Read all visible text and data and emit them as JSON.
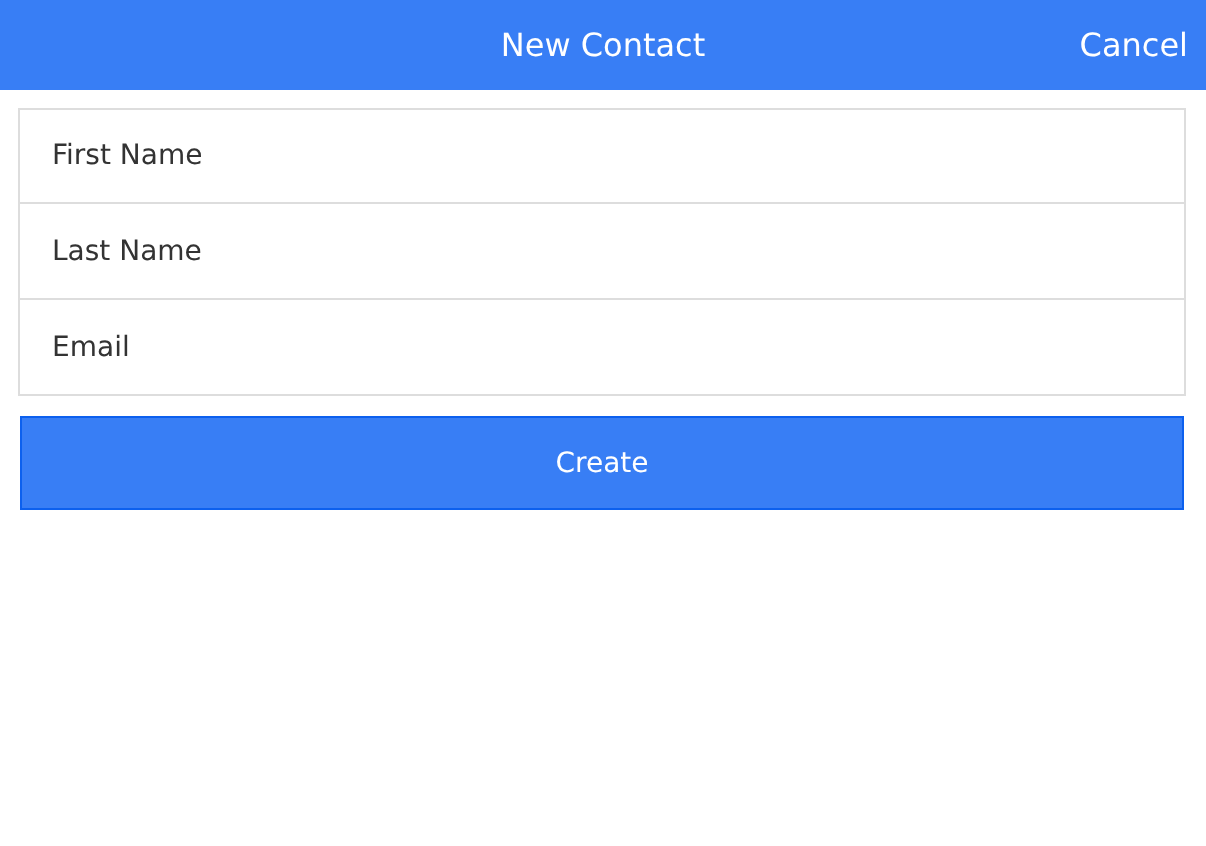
{
  "header": {
    "title": "New Contact",
    "cancel": "Cancel"
  },
  "fields": [
    {
      "placeholder": "First Name"
    },
    {
      "placeholder": "Last Name"
    },
    {
      "placeholder": "Email"
    }
  ],
  "button": "Create"
}
